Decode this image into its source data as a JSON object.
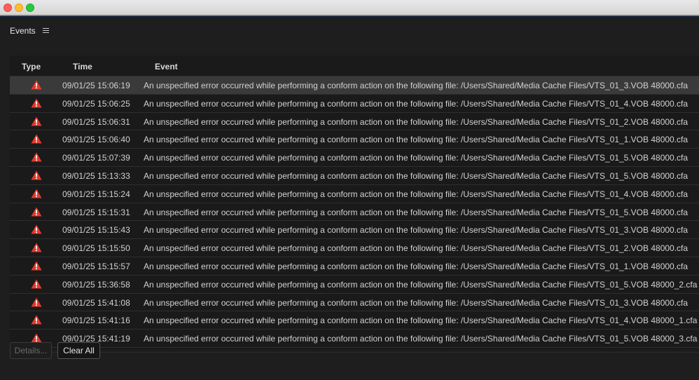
{
  "window": {
    "title_bar_buttons": [
      "close",
      "minimize",
      "maximize"
    ]
  },
  "panel": {
    "title": "Events",
    "menu_icon": "hamburger-menu-icon"
  },
  "table": {
    "columns": [
      "Type",
      "Time",
      "Event"
    ],
    "rows": [
      {
        "type": "warning",
        "time": "09/01/25 15:06:19",
        "event": "An unspecified error occurred while performing a conform action on the following file: /Users/Shared/Media Cache Files/VTS_01_3.VOB 48000.cfa"
      },
      {
        "type": "warning",
        "time": "09/01/25 15:06:25",
        "event": "An unspecified error occurred while performing a conform action on the following file: /Users/Shared/Media Cache Files/VTS_01_4.VOB 48000.cfa"
      },
      {
        "type": "warning",
        "time": "09/01/25 15:06:31",
        "event": "An unspecified error occurred while performing a conform action on the following file: /Users/Shared/Media Cache Files/VTS_01_2.VOB 48000.cfa"
      },
      {
        "type": "warning",
        "time": "09/01/25 15:06:40",
        "event": "An unspecified error occurred while performing a conform action on the following file: /Users/Shared/Media Cache Files/VTS_01_1.VOB 48000.cfa"
      },
      {
        "type": "warning",
        "time": "09/01/25 15:07:39",
        "event": "An unspecified error occurred while performing a conform action on the following file: /Users/Shared/Media Cache Files/VTS_01_5.VOB 48000.cfa"
      },
      {
        "type": "warning",
        "time": "09/01/25 15:13:33",
        "event": "An unspecified error occurred while performing a conform action on the following file: /Users/Shared/Media Cache Files/VTS_01_5.VOB 48000.cfa"
      },
      {
        "type": "warning",
        "time": "09/01/25 15:15:24",
        "event": "An unspecified error occurred while performing a conform action on the following file: /Users/Shared/Media Cache Files/VTS_01_4.VOB 48000.cfa"
      },
      {
        "type": "warning",
        "time": "09/01/25 15:15:31",
        "event": "An unspecified error occurred while performing a conform action on the following file: /Users/Shared/Media Cache Files/VTS_01_5.VOB 48000.cfa"
      },
      {
        "type": "warning",
        "time": "09/01/25 15:15:43",
        "event": "An unspecified error occurred while performing a conform action on the following file: /Users/Shared/Media Cache Files/VTS_01_3.VOB 48000.cfa"
      },
      {
        "type": "warning",
        "time": "09/01/25 15:15:50",
        "event": "An unspecified error occurred while performing a conform action on the following file: /Users/Shared/Media Cache Files/VTS_01_2.VOB 48000.cfa"
      },
      {
        "type": "warning",
        "time": "09/01/25 15:15:57",
        "event": "An unspecified error occurred while performing a conform action on the following file: /Users/Shared/Media Cache Files/VTS_01_1.VOB 48000.cfa"
      },
      {
        "type": "warning",
        "time": "09/01/25 15:36:58",
        "event": "An unspecified error occurred while performing a conform action on the following file: /Users/Shared/Media Cache Files/VTS_01_5.VOB 48000_2.cfa"
      },
      {
        "type": "warning",
        "time": "09/01/25 15:41:08",
        "event": "An unspecified error occurred while performing a conform action on the following file: /Users/Shared/Media Cache Files/VTS_01_3.VOB 48000.cfa"
      },
      {
        "type": "warning",
        "time": "09/01/25 15:41:16",
        "event": "An unspecified error occurred while performing a conform action on the following file: /Users/Shared/Media Cache Files/VTS_01_4.VOB 48000_1.cfa"
      },
      {
        "type": "warning",
        "time": "09/01/25 15:41:19",
        "event": "An unspecified error occurred while performing a conform action on the following file: /Users/Shared/Media Cache Files/VTS_01_5.VOB 48000_3.cfa"
      }
    ]
  },
  "buttons": {
    "details": "Details...",
    "clear_all": "Clear All"
  },
  "colors": {
    "warning": "#e5392b",
    "accent": "#2d72d9"
  }
}
